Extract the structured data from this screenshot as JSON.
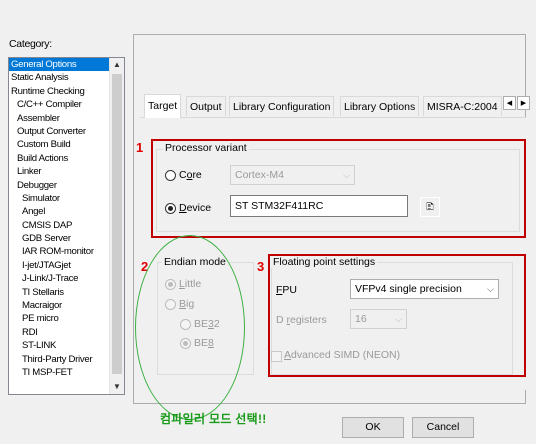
{
  "category_label": "Category:",
  "categories": [
    {
      "label": "General Options",
      "level": 0,
      "selected": true
    },
    {
      "label": "Static Analysis",
      "level": 0
    },
    {
      "label": "Runtime Checking",
      "level": 0
    },
    {
      "label": "C/C++ Compiler",
      "level": 1
    },
    {
      "label": "Assembler",
      "level": 1
    },
    {
      "label": "Output Converter",
      "level": 1
    },
    {
      "label": "Custom Build",
      "level": 1
    },
    {
      "label": "Build Actions",
      "level": 1
    },
    {
      "label": "Linker",
      "level": 1
    },
    {
      "label": "Debugger",
      "level": 1
    },
    {
      "label": "Simulator",
      "level": 2
    },
    {
      "label": "Angel",
      "level": 2
    },
    {
      "label": "CMSIS DAP",
      "level": 2
    },
    {
      "label": "GDB Server",
      "level": 2
    },
    {
      "label": "IAR ROM-monitor",
      "level": 2
    },
    {
      "label": "I-jet/JTAGjet",
      "level": 2
    },
    {
      "label": "J-Link/J-Trace",
      "level": 2
    },
    {
      "label": "TI Stellaris",
      "level": 2
    },
    {
      "label": "Macraigor",
      "level": 2
    },
    {
      "label": "PE micro",
      "level": 2
    },
    {
      "label": "RDI",
      "level": 2
    },
    {
      "label": "ST-LINK",
      "level": 2
    },
    {
      "label": "Third-Party Driver",
      "level": 2
    },
    {
      "label": "TI MSP-FET",
      "level": 2
    }
  ],
  "tabs": [
    "Target",
    "Output",
    "Library Configuration",
    "Library Options",
    "MISRA-C:2004"
  ],
  "annotations": {
    "n1": "1",
    "n2": "2",
    "n3": "3",
    "note": "컴파일러 모드 선택!!"
  },
  "processor": {
    "title": "Processor variant",
    "core_prefix": "C",
    "core_ul": "o",
    "core_rest": "re",
    "core_value": "Cortex-M4",
    "device_ul": "D",
    "device_rest": "evice",
    "device_value": "ST STM32F411RC"
  },
  "endian": {
    "title": "Endian mode",
    "little_ul": "L",
    "little_rest": "ittle",
    "big_ul": "B",
    "big_rest": "ig",
    "be32_prefix": "BE",
    "be32_ul": "3",
    "be32_rest": "2",
    "be8_prefix": "BE",
    "be8_ul": "8"
  },
  "fpu": {
    "title": "Floating point settings",
    "fpu_ul": "F",
    "fpu_rest": "PU",
    "fpu_value": "VFPv4 single precision",
    "dreg_prefix": "D ",
    "dreg_ul": "r",
    "dreg_rest": "egisters",
    "dreg_value": "16",
    "simd_ul": "A",
    "simd_rest": "dvanced SIMD (NEON)"
  },
  "buttons": {
    "ok": "OK",
    "cancel": "Cancel"
  },
  "colors": {
    "selection": "#0078d7",
    "annotation_red": "#c00000",
    "annotation_green": "#3cb043"
  }
}
